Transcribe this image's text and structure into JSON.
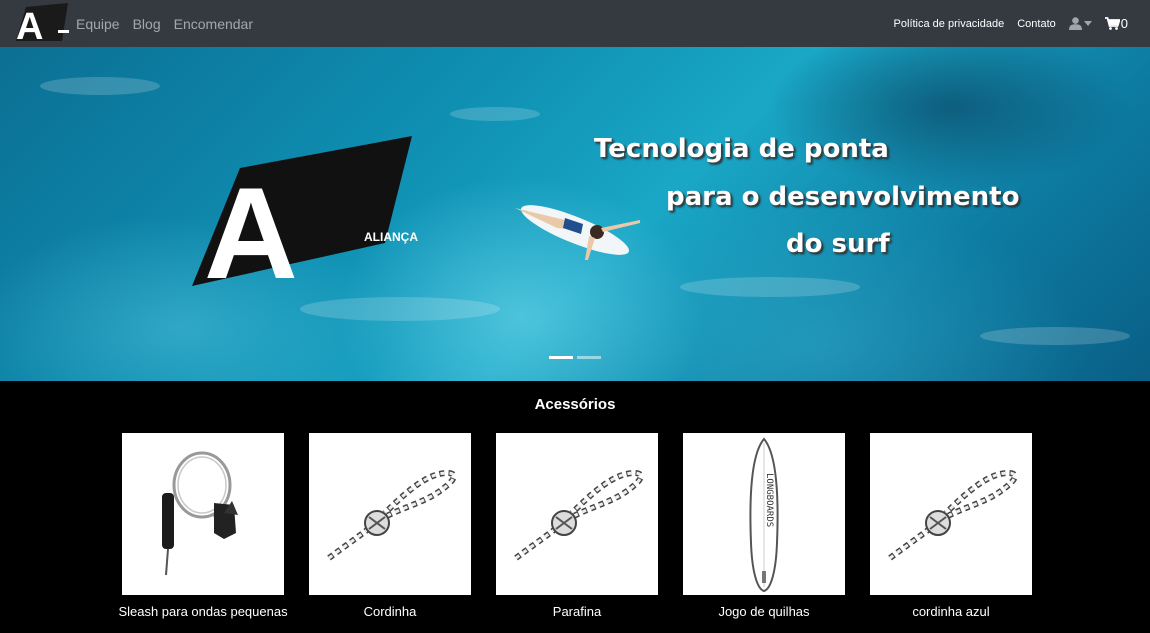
{
  "nav": {
    "brand_icon": "alianca-logo",
    "links_left": [
      "Equipe",
      "Blog",
      "Encomendar"
    ],
    "links_right": [
      "Política de privacidade",
      "Contato"
    ],
    "user_icon": "user-icon",
    "cart_icon": "cart-icon",
    "cart_count": "0"
  },
  "hero": {
    "logo_word": "ALIANÇA",
    "logo_letter": "A",
    "line1": "Tecnologia de ponta",
    "line2": "para o desenvolvimento",
    "line3": "do surf",
    "slides": 2,
    "active_slide": 1
  },
  "section": {
    "title": "Acessórios"
  },
  "products": [
    {
      "name": "Sleash para ondas pequenas",
      "image": "leash"
    },
    {
      "name": "Cordinha",
      "image": "rope"
    },
    {
      "name": "Parafina",
      "image": "rope"
    },
    {
      "name": "Jogo de quilhas",
      "image": "longboard",
      "board_text": "LONGBOARDS"
    },
    {
      "name": "cordinha azul",
      "image": "rope"
    }
  ],
  "colors": {
    "navbar": "#343a40",
    "page_bg": "#000000",
    "ocean": "#0f90b3"
  }
}
